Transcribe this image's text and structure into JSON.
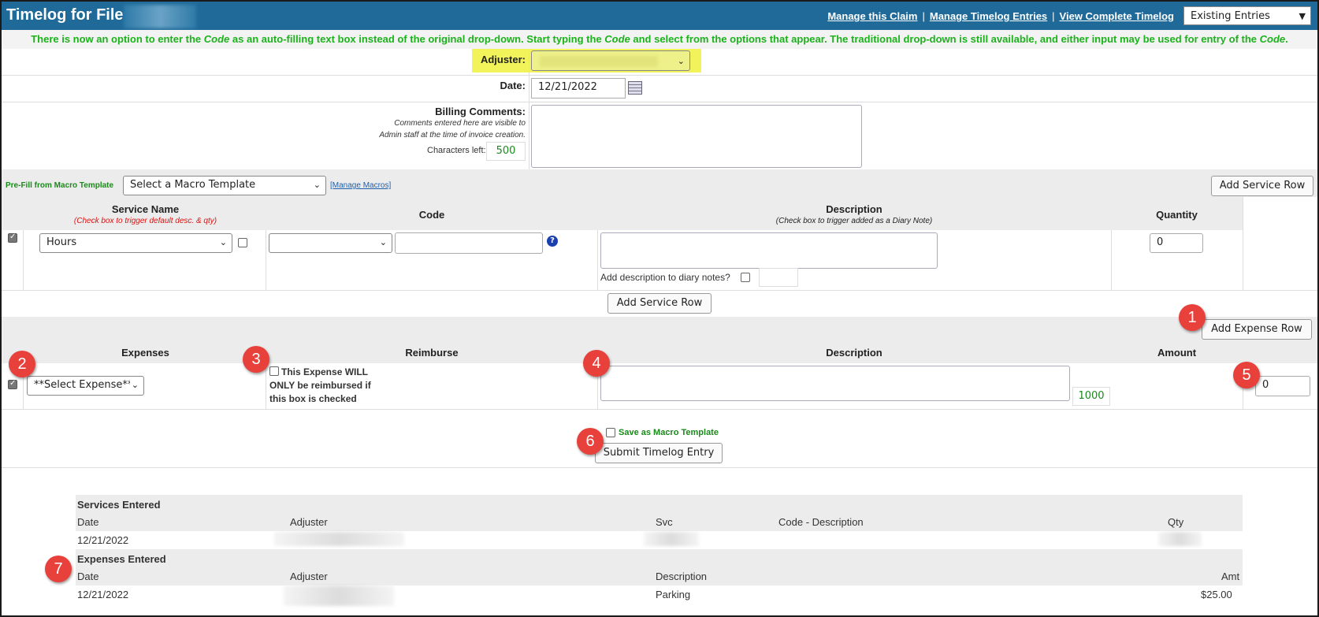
{
  "header": {
    "title": "Timelog for File #",
    "links": [
      "Manage this Claim",
      "Manage Timelog Entries",
      "View Complete Timelog"
    ],
    "view_select": "Existing Entries"
  },
  "notice": {
    "parts": [
      "There is now an option to enter the ",
      "Code",
      " as an auto-filling text box instead of the original drop-down. Start typing the ",
      "Code",
      " and select from the options that appear. The traditional drop-down is still available, and either input may be used for entry of the ",
      "Code",
      "."
    ]
  },
  "form": {
    "adjuster_label": "Adjuster:",
    "date_label": "Date:",
    "date_value": "12/21/2022",
    "billing_label": "Billing Comments:",
    "billing_note_1": "Comments entered here are visible to",
    "billing_note_2": "Admin staff at the time of invoice creation.",
    "chars_left_label": "Characters left:",
    "chars_left_value": "500"
  },
  "macro": {
    "prefill_label": "Pre-Fill from Macro Template",
    "select_value": "Select a Macro Template",
    "manage_link": "[Manage Macros]",
    "add_service_row": "Add Service Row"
  },
  "services": {
    "col_service_name": "Service Name",
    "col_service_sub": "(Check box to trigger default desc. & qty)",
    "col_code": "Code",
    "col_description": "Description",
    "col_description_sub": "(Check box to trigger added as a Diary Note)",
    "col_quantity": "Quantity",
    "service_value": "Hours",
    "help_icon": "?",
    "diary_label": "Add description to diary notes?",
    "quantity_value": "0",
    "add_service_row": "Add Service Row"
  },
  "expenses": {
    "add_expense_row": "Add Expense Row",
    "col_expenses": "Expenses",
    "col_reimburse": "Reimburse",
    "col_description": "Description",
    "col_amount": "Amount",
    "expense_select": "**Select Expense**",
    "reimburse_1": "This Expense WILL",
    "reimburse_2": "ONLY be reimbursed if",
    "reimburse_3": "this box is checked",
    "chars_left": "1000",
    "amount_value": "0"
  },
  "submit": {
    "macro_label": "Save as Macro Template",
    "submit_button": "Submit Timelog Entry"
  },
  "services_entered": {
    "heading": "Services Entered",
    "columns": [
      "Date",
      "Adjuster",
      "Svc",
      "Code - Description",
      "Qty"
    ],
    "row_date": "12/21/2022"
  },
  "expenses_entered": {
    "heading": "Expenses Entered",
    "columns": [
      "Date",
      "Adjuster",
      "Description",
      "Amt"
    ],
    "row_date": "12/21/2022",
    "row_description": "Parking",
    "row_amount": "$25.00"
  },
  "badges": [
    "1",
    "2",
    "3",
    "4",
    "5",
    "6",
    "7"
  ],
  "colors": {
    "header_blue": "#1f6a99",
    "notice_green": "#1bb21b",
    "warning_red": "#dd1111",
    "badge_red": "#e8403a",
    "highlight_yellow": "#f2f25a"
  }
}
